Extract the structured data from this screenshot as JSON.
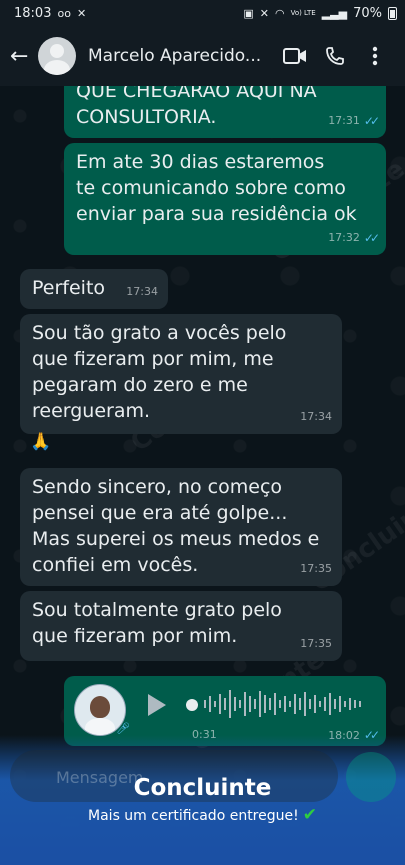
{
  "status_bar": {
    "time": "18:03",
    "battery": "70%",
    "network": "Vo) LTE"
  },
  "header": {
    "contact_name": "Marcelo Aparecido..."
  },
  "messages": [
    {
      "direction": "out",
      "lines": [
        "QUE CHEGARAO AQUI NA",
        "CONSULTORIA."
      ],
      "time": "17:31"
    },
    {
      "direction": "out",
      "lines": [
        "Em ate 30 dias estaremos",
        "te comunicando sobre como",
        "enviar para sua residência ok"
      ],
      "time": "17:32"
    },
    {
      "direction": "in",
      "lines": [
        "Perfeito"
      ],
      "time": "17:34"
    },
    {
      "direction": "in",
      "lines": [
        "Sou tão grato a vocês pelo",
        "que fizeram por mim, me",
        "pegaram do zero e me",
        "reergueram."
      ],
      "time": "17:34"
    },
    {
      "direction": "in",
      "lines": [
        "🙏"
      ],
      "time": ""
    },
    {
      "direction": "in",
      "lines": [
        "Sendo sincero, no começo",
        "pensei que era até golpe...",
        "Mas superei os meus medos e",
        "confiei em vocês."
      ],
      "time": "17:35"
    },
    {
      "direction": "in",
      "lines": [
        "Sou totalmente grato pelo",
        "que fizeram por mim."
      ],
      "time": "17:35"
    }
  ],
  "voice_message": {
    "duration": "0:31",
    "time": "18:02"
  },
  "input": {
    "placeholder": "Mensagem"
  },
  "overlay": {
    "brand": "Concluinte",
    "tagline": "Mais um certificado entregue!",
    "watermark": "Concluinte"
  },
  "colors": {
    "outgoing": "#005c4b",
    "incoming": "#202c33",
    "background": "#0b141a",
    "read_ticks": "#53bdeb",
    "brand_blue": "#1b4fa4",
    "check_green": "#2ecc40"
  }
}
